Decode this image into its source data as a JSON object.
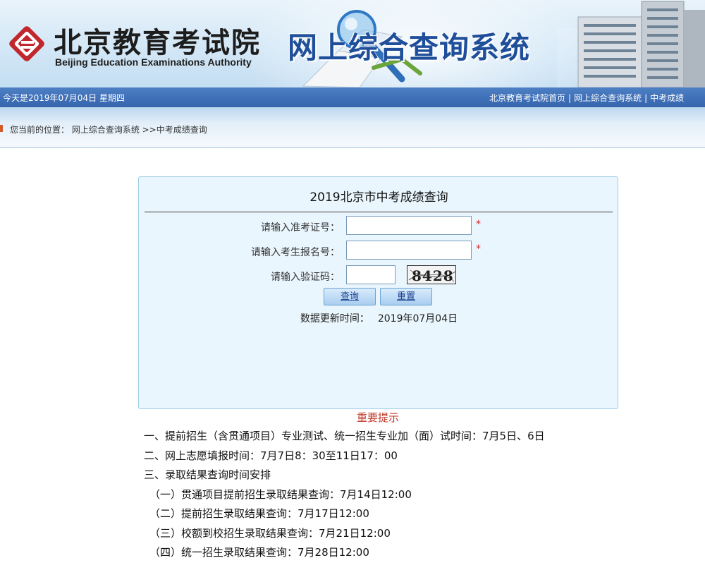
{
  "header": {
    "org_name_cn": "北京教育考试院",
    "org_name_en": "Beijing Education Examinations Authority",
    "system_title": "网上综合查询系统",
    "brand_color": "#3565ad",
    "title_color": "#1f4f9a"
  },
  "navbar": {
    "date_text": "今天是2019年07月04日  星期四",
    "links": [
      {
        "label": "北京教育考试院首页"
      },
      {
        "label": "网上综合查询系统"
      },
      {
        "label": "中考成绩"
      }
    ],
    "separator": "|"
  },
  "breadcrumb": {
    "text": "您当前的位置：  网上综合查询系统 >>中考成绩查询"
  },
  "query": {
    "title": "2019北京市中考成绩查询",
    "fields": [
      {
        "label": "请输入准考证号：",
        "value": "",
        "required_mark": "*"
      },
      {
        "label": "请输入考生报名号：",
        "value": "",
        "required_mark": "*"
      },
      {
        "label": "请输入验证码：",
        "value": ""
      }
    ],
    "captcha_text": "8428",
    "buttons": {
      "submit": "查询",
      "reset": "重置"
    },
    "update_label": "数据更新时间：",
    "update_value": "2019年07月04日"
  },
  "notice": {
    "title": "重要提示",
    "title_color": "#c0392b",
    "lines": [
      "一、提前招生（含贯通项目）专业测试、统一招生专业加（面）试时间：7月5日、6日",
      "二、网上志愿填报时间：7月7日8：30至11日17：00",
      "三、录取结果查询时间安排",
      "（一）贯通项目提前招生录取结果查询：7月14日12:00",
      "（二）提前招生录取结果查询：7月17日12:00",
      "（三）校额到校招生录取结果查询：7月21日12:00",
      "（四）统一招生录取结果查询：7月28日12:00"
    ]
  }
}
